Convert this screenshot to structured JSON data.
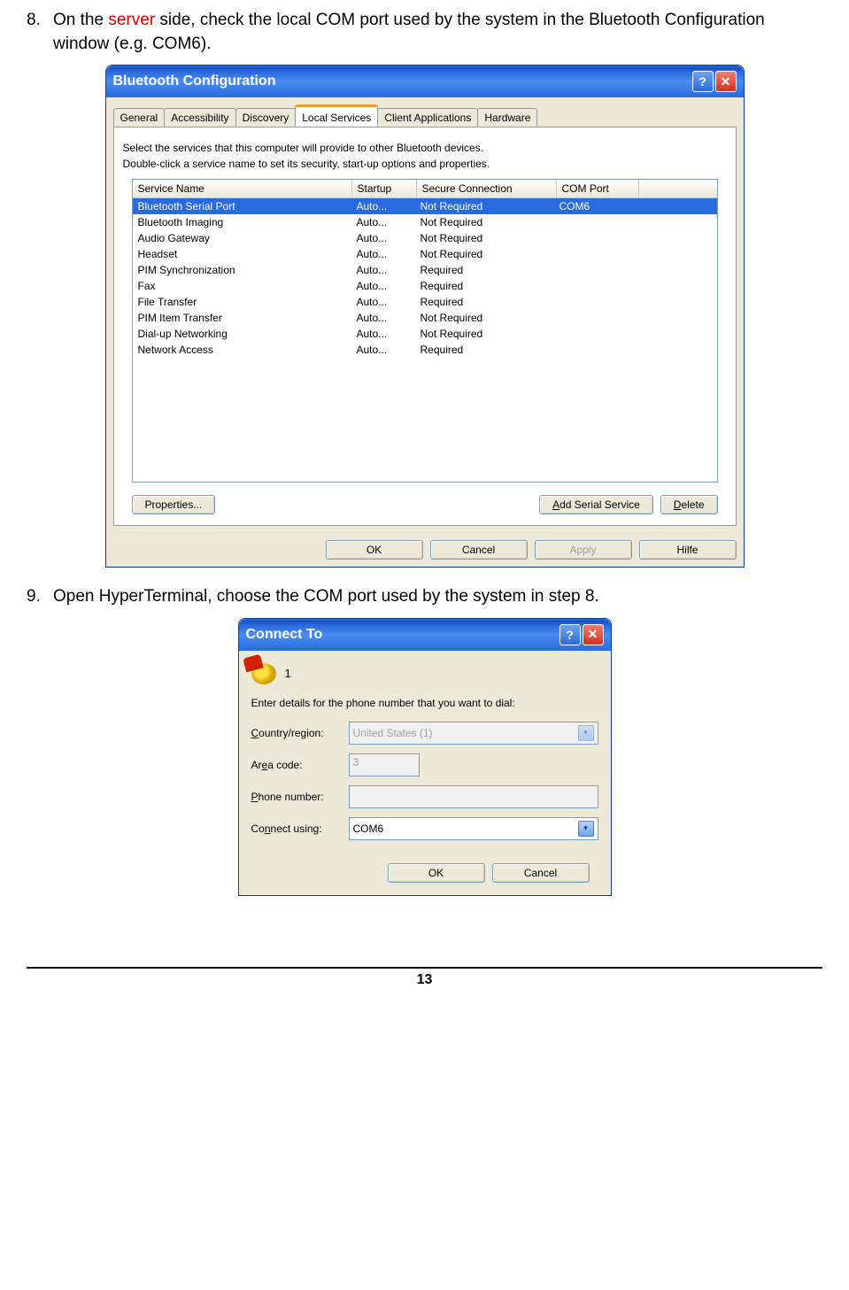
{
  "step8": {
    "num": "8.",
    "pre": "On the ",
    "server": "server",
    "post": " side, check the local COM port used by the system in the Bluetooth Configuration window (e.g. COM6)."
  },
  "step9": {
    "num": "9.",
    "text": "Open HyperTerminal, choose the COM port used by the system in step 8."
  },
  "bt": {
    "title": "Bluetooth Configuration",
    "tabs": [
      "General",
      "Accessibility",
      "Discovery",
      "Local Services",
      "Client Applications",
      "Hardware"
    ],
    "active_tab": 3,
    "line1": "Select the services that this computer will provide to other Bluetooth devices.",
    "line2": "Double-click a service name to set its security, start-up options and properties.",
    "headers": [
      "Service Name",
      "Startup",
      "Secure Connection",
      "COM Port"
    ],
    "rows": [
      {
        "name": "Bluetooth Serial Port",
        "startup": "Auto...",
        "secure": "Not Required",
        "port": "COM6",
        "selected": true
      },
      {
        "name": "Bluetooth Imaging",
        "startup": "Auto...",
        "secure": "Not Required",
        "port": "",
        "selected": false
      },
      {
        "name": "Audio Gateway",
        "startup": "Auto...",
        "secure": "Not Required",
        "port": "",
        "selected": false
      },
      {
        "name": "Headset",
        "startup": "Auto...",
        "secure": "Not Required",
        "port": "",
        "selected": false
      },
      {
        "name": "PIM Synchronization",
        "startup": "Auto...",
        "secure": "Required",
        "port": "",
        "selected": false
      },
      {
        "name": "Fax",
        "startup": "Auto...",
        "secure": "Required",
        "port": "",
        "selected": false
      },
      {
        "name": "File Transfer",
        "startup": "Auto...",
        "secure": "Required",
        "port": "",
        "selected": false
      },
      {
        "name": "PIM Item Transfer",
        "startup": "Auto...",
        "secure": "Not Required",
        "port": "",
        "selected": false
      },
      {
        "name": "Dial-up Networking",
        "startup": "Auto...",
        "secure": "Not Required",
        "port": "",
        "selected": false
      },
      {
        "name": "Network Access",
        "startup": "Auto...",
        "secure": "Required",
        "port": "",
        "selected": false
      }
    ],
    "btn_props": "Properties...",
    "btn_add_pre": "A",
    "btn_add_mid": "dd Serial Service",
    "btn_del_pre": "D",
    "btn_del_mid": "elete",
    "btn_ok": "OK",
    "btn_cancel": "Cancel",
    "btn_apply": "Apply",
    "btn_hilfe": "Hilfe"
  },
  "ct": {
    "title": "Connect To",
    "conn_name": "1",
    "enter_details": "Enter details for the phone number that you want to dial:",
    "country_label_pre": "C",
    "country_label_mid": "ountry/region:",
    "country_value": "United States (1)",
    "area_label_pre": "Ar",
    "area_label_u": "e",
    "area_label_post": "a code:",
    "area_value": "3",
    "phone_label_pre": "P",
    "phone_label_mid": "hone number:",
    "phone_value": "",
    "connect_label_pre": "Co",
    "connect_label_u": "n",
    "connect_label_post": "nect using:",
    "connect_value": "COM6",
    "btn_ok": "OK",
    "btn_cancel": "Cancel"
  },
  "page_num": "13"
}
